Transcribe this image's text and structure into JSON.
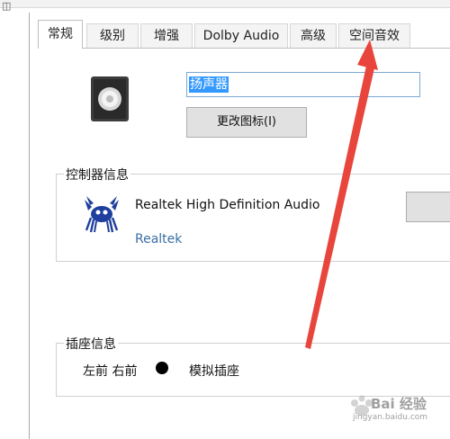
{
  "tabs": [
    {
      "label": "常规",
      "active": true
    },
    {
      "label": "级别",
      "active": false
    },
    {
      "label": "增强",
      "active": false
    },
    {
      "label": "Dolby Audio",
      "active": false
    },
    {
      "label": "高级",
      "active": false
    },
    {
      "label": "空间音效",
      "active": false
    }
  ],
  "device": {
    "name_value": "扬声器",
    "change_icon_label": "更改图标(I)"
  },
  "controller": {
    "group_title": "控制器信息",
    "name": "Realtek High Definition Audio",
    "vendor": "Realtek"
  },
  "jack": {
    "group_title": "插座信息",
    "position": "左前 右前",
    "type": "模拟插座"
  },
  "watermark": {
    "title": "Bai 经验",
    "url": "jingyan.baidu.com"
  },
  "colors": {
    "arrow": "#e8453c",
    "selection": "#3399ff",
    "vendor_link": "#3a6ea5"
  }
}
